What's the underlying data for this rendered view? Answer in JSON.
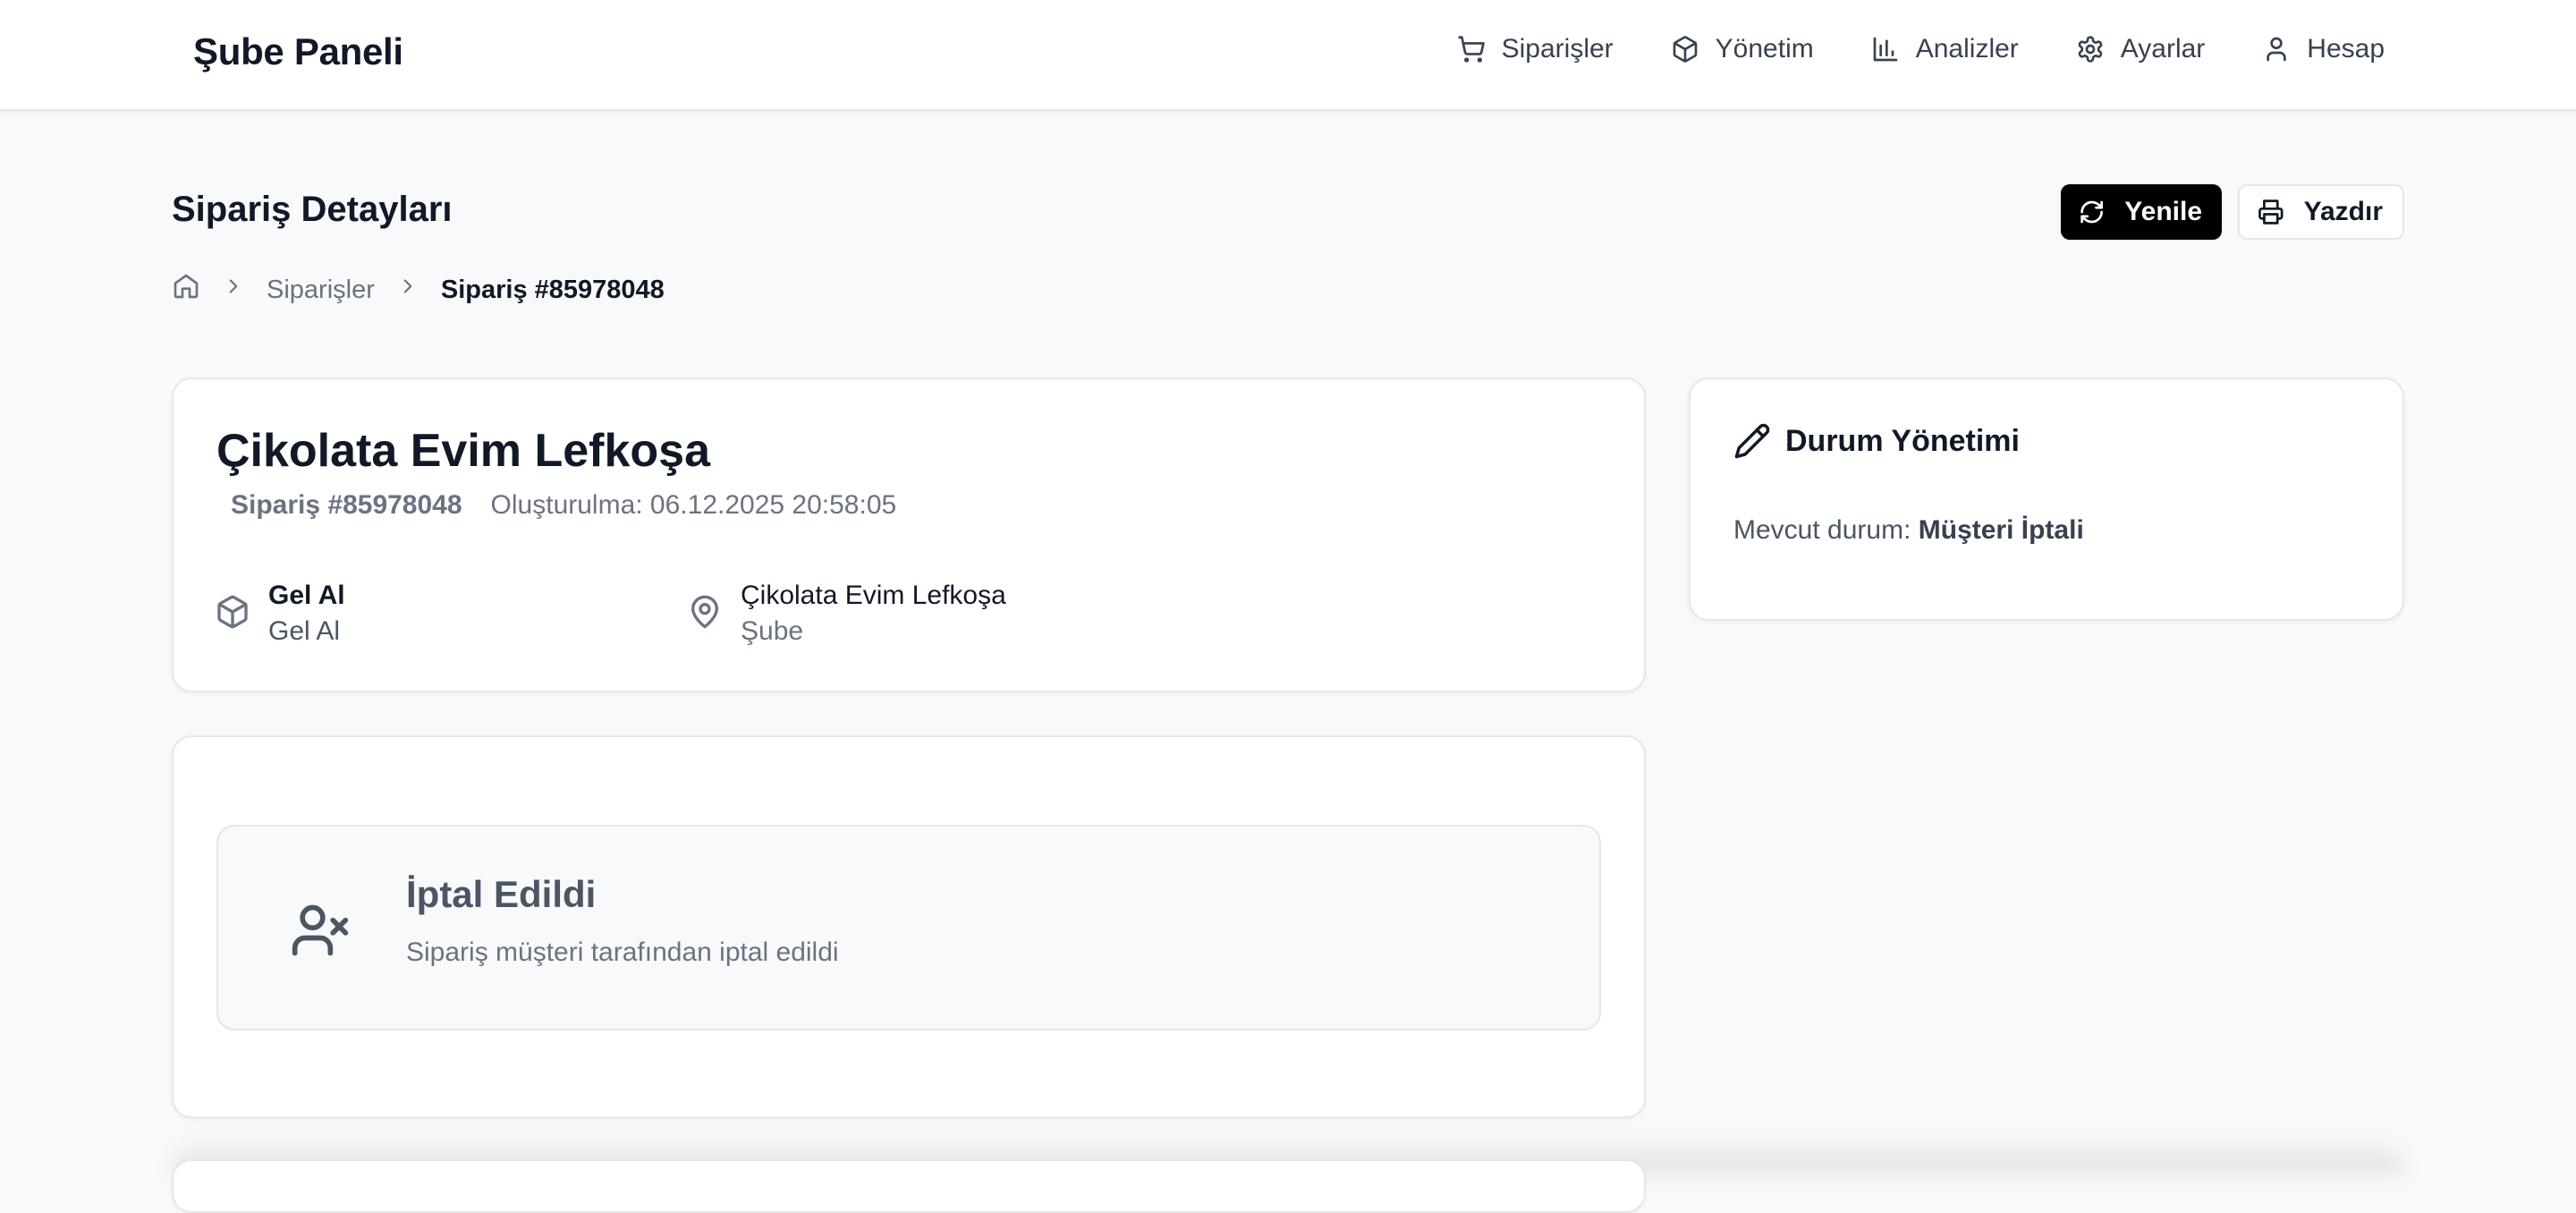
{
  "app": {
    "brand": "Şube Paneli"
  },
  "nav": [
    {
      "label": "Siparişler",
      "icon": "cart-icon"
    },
    {
      "label": "Yönetim",
      "icon": "package-icon"
    },
    {
      "label": "Analizler",
      "icon": "bar-chart-icon"
    },
    {
      "label": "Ayarlar",
      "icon": "gear-icon"
    },
    {
      "label": "Hesap",
      "icon": "user-icon"
    }
  ],
  "page": {
    "title": "Sipariş Detayları"
  },
  "actions": {
    "refresh_label": "Yenile",
    "print_label": "Yazdır"
  },
  "breadcrumb": {
    "link": "Siparişler",
    "current": "Sipariş #85978048"
  },
  "order": {
    "store_name": "Çikolata Evim Lefkoşa",
    "order_no": "Sipariş #85978048",
    "created": "Oluşturulma: 06.12.2025 20:58:05",
    "delivery_type": "Gel Al",
    "delivery_sub": "Gel Al",
    "branch_name": "Çikolata Evim Lefkoşa",
    "branch_sub": "Şube"
  },
  "status": {
    "heading": "Durum Yönetimi",
    "current_prefix": "Mevcut durum:",
    "current_value": "Müşteri İptali"
  },
  "cancel": {
    "title": "İptal Edildi",
    "description": "Sipariş müşteri tarafından iptal edildi"
  },
  "colors": {
    "primary": "#000000",
    "background": "#f8f9fa",
    "card": "#ffffff",
    "muted": "#6b7280"
  }
}
